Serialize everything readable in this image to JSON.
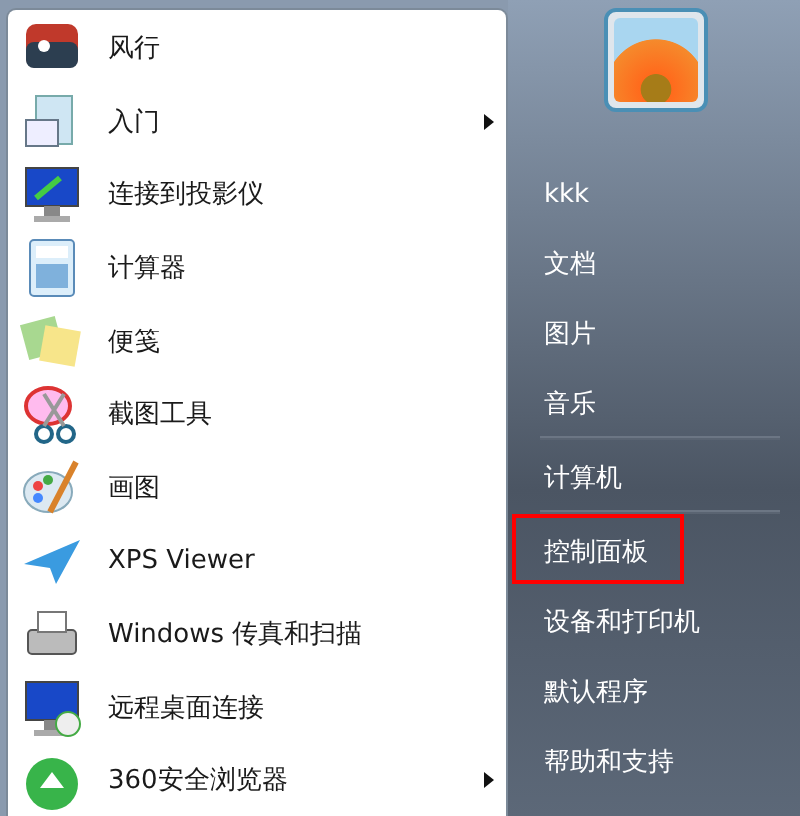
{
  "programs": [
    {
      "label": "风行",
      "has_submenu": false
    },
    {
      "label": "入门",
      "has_submenu": true
    },
    {
      "label": "连接到投影仪",
      "has_submenu": false
    },
    {
      "label": "计算器",
      "has_submenu": false
    },
    {
      "label": "便笺",
      "has_submenu": false
    },
    {
      "label": "截图工具",
      "has_submenu": false
    },
    {
      "label": "画图",
      "has_submenu": false
    },
    {
      "label": "XPS Viewer",
      "has_submenu": false
    },
    {
      "label": "Windows 传真和扫描",
      "has_submenu": false
    },
    {
      "label": "远程桌面连接",
      "has_submenu": false
    },
    {
      "label": "360安全浏览器",
      "has_submenu": true
    }
  ],
  "places": [
    {
      "label": "kkk",
      "highlighted": false,
      "divider_after": false
    },
    {
      "label": "文档",
      "highlighted": false,
      "divider_after": false
    },
    {
      "label": "图片",
      "highlighted": false,
      "divider_after": false
    },
    {
      "label": "音乐",
      "highlighted": false,
      "divider_after": true
    },
    {
      "label": "计算机",
      "highlighted": false,
      "divider_after": true
    },
    {
      "label": "控制面板",
      "highlighted": true,
      "divider_after": false
    },
    {
      "label": "设备和打印机",
      "highlighted": false,
      "divider_after": false
    },
    {
      "label": "默认程序",
      "highlighted": false,
      "divider_after": false
    },
    {
      "label": "帮助和支持",
      "highlighted": false,
      "divider_after": false
    }
  ]
}
